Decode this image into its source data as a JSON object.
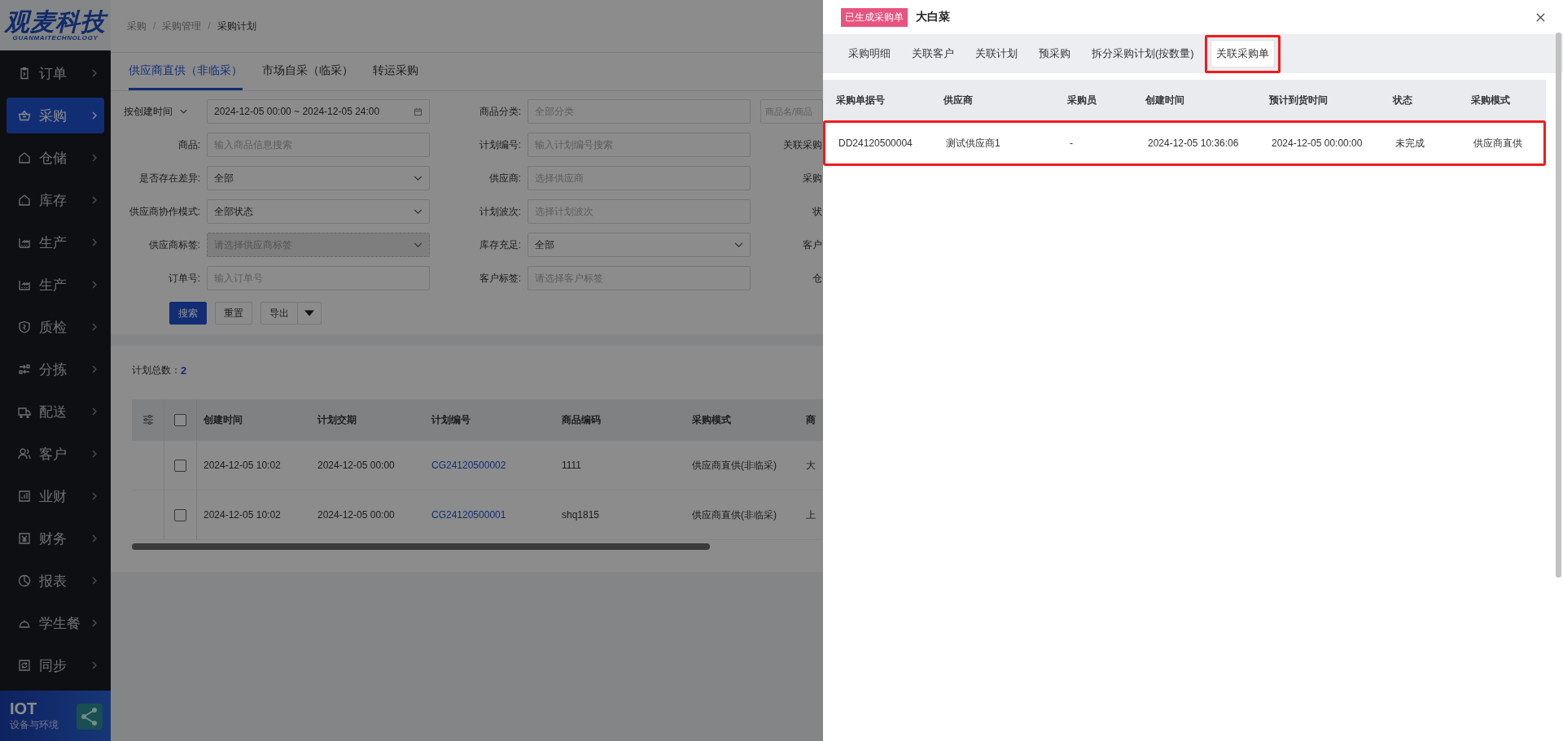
{
  "sidebar": {
    "logo": "观麦科技",
    "logo_sub": "GUANMAITECHNOLOGY",
    "items": [
      {
        "label": "订单",
        "selected": false
      },
      {
        "label": "采购",
        "selected": true
      },
      {
        "label": "仓储",
        "selected": false
      },
      {
        "label": "库存",
        "selected": false
      },
      {
        "label": "生产",
        "selected": false
      },
      {
        "label": "生产",
        "selected": false
      },
      {
        "label": "质检",
        "selected": false
      },
      {
        "label": "分拣",
        "selected": false
      },
      {
        "label": "配送",
        "selected": false
      },
      {
        "label": "客户",
        "selected": false
      },
      {
        "label": "业财",
        "selected": false
      },
      {
        "label": "财务",
        "selected": false
      },
      {
        "label": "报表",
        "selected": false
      },
      {
        "label": "学生餐",
        "selected": false
      },
      {
        "label": "同步",
        "selected": false
      }
    ],
    "iot": {
      "title": "IOT",
      "subtitle": "设备与环境"
    }
  },
  "breadcrumb": [
    "采购",
    "采购管理",
    "采购计划"
  ],
  "breadcrumb_separator": "/",
  "tabs": [
    {
      "label": "供应商直供（非临采）",
      "selected": true
    },
    {
      "label": "市场自采（临采）",
      "selected": false
    },
    {
      "label": "转运采购",
      "selected": false
    }
  ],
  "filters": [
    {
      "kind": "date-range",
      "label": "按创建时间",
      "value": "2024-12-05 00:00 ~ 2024-12-05 24:00",
      "disabled": false
    },
    {
      "kind": "input",
      "label": "商品分类:",
      "placeholder": "全部分类",
      "disabled": false
    },
    {
      "kind": "input",
      "placeholder": "商品名/商品",
      "disabled": false
    },
    {
      "kind": "input",
      "label": "商品:",
      "placeholder": "输入商品信息搜索",
      "disabled": false
    },
    {
      "kind": "input",
      "label": "计划编号:",
      "placeholder": "输入计划编号搜索",
      "disabled": false
    },
    {
      "kind": "label",
      "label": "关联采购"
    },
    {
      "kind": "select",
      "label": "是否存在差异:",
      "value": "全部",
      "disabled": false
    },
    {
      "kind": "input",
      "label": "供应商:",
      "placeholder": "选择供应商",
      "disabled": false
    },
    {
      "kind": "label",
      "label": "采购"
    },
    {
      "kind": "select",
      "label": "供应商协作模式:",
      "value": "全部状态",
      "disabled": false
    },
    {
      "kind": "input",
      "label": "计划波次:",
      "placeholder": "选择计划波次",
      "disabled": false
    },
    {
      "kind": "label",
      "label": "状"
    },
    {
      "kind": "select",
      "label": "供应商标签:",
      "placeholder": "请选择供应商标签",
      "disabled": true
    },
    {
      "kind": "select",
      "label": "库存充足:",
      "value": "全部",
      "disabled": false
    },
    {
      "kind": "label",
      "label": "客户"
    },
    {
      "kind": "input",
      "label": "订单号:",
      "placeholder": "输入订单号",
      "disabled": false
    },
    {
      "kind": "input",
      "label": "客户标签:",
      "placeholder": "请选择客户标签",
      "disabled": false
    },
    {
      "kind": "label",
      "label": "仓"
    }
  ],
  "buttons": [
    {
      "label": "搜索",
      "kind": "primary"
    },
    {
      "label": "重置",
      "kind": "default"
    },
    {
      "label": "导出",
      "kind": "split"
    }
  ],
  "table": {
    "count_label": "计划总数：",
    "count": "2",
    "all_checked": false,
    "columns": [
      "创建时间",
      "计划交期",
      "计划编号",
      "商品编码",
      "采购模式",
      "商"
    ],
    "rows": [
      {
        "checked": false,
        "cells": [
          "2024-12-05 10:02",
          "2024-12-05 00:00",
          "CG24120500002",
          "1111",
          "供应商直供(非临采)",
          "大"
        ]
      },
      {
        "checked": false,
        "cells": [
          "2024-12-05 10:02",
          "2024-12-05 00:00",
          "CG24120500001",
          "shq1815",
          "供应商直供(非临采)",
          "上"
        ]
      }
    ]
  },
  "drawer": {
    "tag": "已生成采购单",
    "title": "大白菜",
    "tabs": [
      {
        "label": "采购明细",
        "selected": false,
        "annotated": false
      },
      {
        "label": "关联客户",
        "selected": false,
        "annotated": false
      },
      {
        "label": "关联计划",
        "selected": false,
        "annotated": false
      },
      {
        "label": "预采购",
        "selected": false,
        "annotated": false
      },
      {
        "label": "拆分采购计划(按数量)",
        "selected": false,
        "annotated": false
      },
      {
        "label": "关联采购单",
        "selected": true,
        "annotated": true
      }
    ],
    "table": {
      "columns": [
        "采购单据号",
        "供应商",
        "采购员",
        "创建时间",
        "预计到货时间",
        "状态",
        "采购模式"
      ],
      "rows": [
        {
          "annotated": true,
          "cells": [
            "DD24120500004",
            "测试供应商1",
            "-",
            "2024-12-05 10:36:06",
            "2024-12-05 00:00:00",
            "未完成",
            "供应商直供"
          ]
        }
      ]
    }
  }
}
